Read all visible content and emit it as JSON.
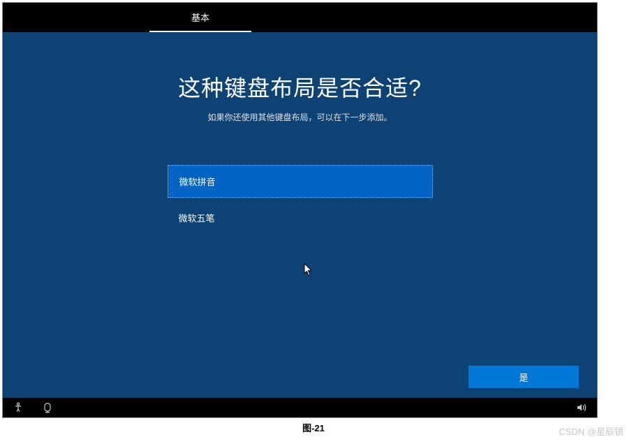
{
  "tabs": {
    "basic": "基本"
  },
  "heading": "这种键盘布局是否合适?",
  "subheading": "如果你还使用其他键盘布局，可以在下一步添加。",
  "options": {
    "selected": "微软拼音",
    "other": "微软五笔"
  },
  "confirm": "是",
  "caption": "图-21",
  "watermark": "CSDN @星辰镜",
  "icons": {
    "accessibility": "accessibility-icon",
    "ime": "ime-icon",
    "volume": "volume-icon"
  }
}
